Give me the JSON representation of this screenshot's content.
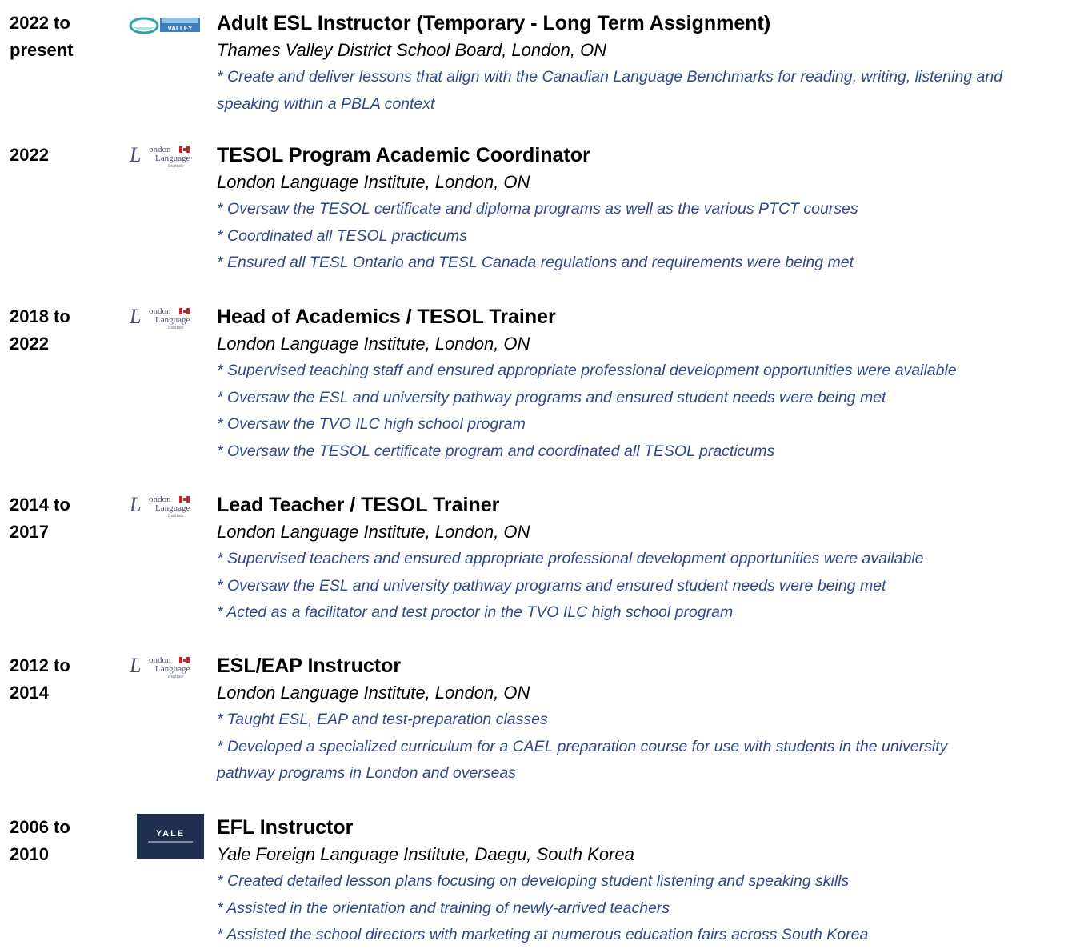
{
  "entries": [
    {
      "years": [
        "2022 to",
        "present"
      ],
      "logo": "thames-valley-logo",
      "logo_text": "VALLEY",
      "title": "Adult ESL Instructor (Temporary - Long Term Assignment)",
      "employer": "Thames Valley District School Board, London, ON",
      "duties": [
        "* Create and deliver lessons that align with the Canadian Language Benchmarks for reading, writing, listening and speaking within a PBLA context"
      ]
    },
    {
      "years": [
        "2022",
        ""
      ],
      "logo": "london-language-institute-logo",
      "title": "TESOL Program Academic Coordinator",
      "employer": "London Language Institute, London, ON",
      "duties": [
        "* Oversaw the TESOL certificate and diploma programs as well as the various PTCT courses",
        "* Coordinated all TESOL practicums",
        "* Ensured all TESL Ontario and TESL Canada regulations and requirements were being met"
      ]
    },
    {
      "years": [
        "2018 to",
        "2022"
      ],
      "logo": "london-language-institute-logo",
      "title": "Head of Academics / TESOL Trainer",
      "employer": "London Language Institute, London, ON",
      "duties": [
        "* Supervised teaching staff and ensured appropriate professional development opportunities were available",
        "* Oversaw the ESL and university pathway programs and ensured student needs were being met",
        "* Oversaw the TVO ILC high school program",
        "* Oversaw the TESOL certificate program and coordinated all TESOL practicums"
      ]
    },
    {
      "years": [
        "2014 to",
        "2017"
      ],
      "logo": "london-language-institute-logo",
      "title": "Lead Teacher / TESOL Trainer",
      "employer": "London Language Institute, London, ON",
      "duties": [
        "* Supervised teachers and ensured appropriate professional development opportunities were available",
        "* Oversaw the ESL and university pathway programs and ensured student needs were being met",
        "* Acted as a facilitator and test proctor in the TVO ILC high school program"
      ]
    },
    {
      "years": [
        "2012 to",
        "2014"
      ],
      "logo": "london-language-institute-logo",
      "title": "ESL/EAP Instructor",
      "employer": "London Language Institute, London, ON",
      "duties": [
        "* Taught ESL, EAP and test-preparation classes",
        "* Developed a specialized curriculum for a CAEL preparation course for use with students in the university pathway programs in London and overseas"
      ]
    },
    {
      "years": [
        "2006 to",
        "2010"
      ],
      "logo": "yale-logo",
      "logo_text": "YALE",
      "title": "EFL Instructor",
      "employer": "Yale Foreign Language Institute, Daegu, South Korea",
      "duties": [
        "* Created detailed lesson plans focusing on developing student listening and speaking skills",
        "* Assisted in the orientation and training of newly-arrived teachers",
        "* Assisted the school directors with marketing at numerous education fairs across South Korea"
      ]
    }
  ],
  "lli_logo_text": {
    "script": "L",
    "line1": "ondon",
    "line2": "Language",
    "line3": "Institute"
  },
  "colors": {
    "duty_text": "#2f4a8a",
    "heading_text": "#000000",
    "yale_bg": "#1f2f4f",
    "tvdsb_teal": "#2aa6a8",
    "tvdsb_blue": "#3f7fbf"
  }
}
